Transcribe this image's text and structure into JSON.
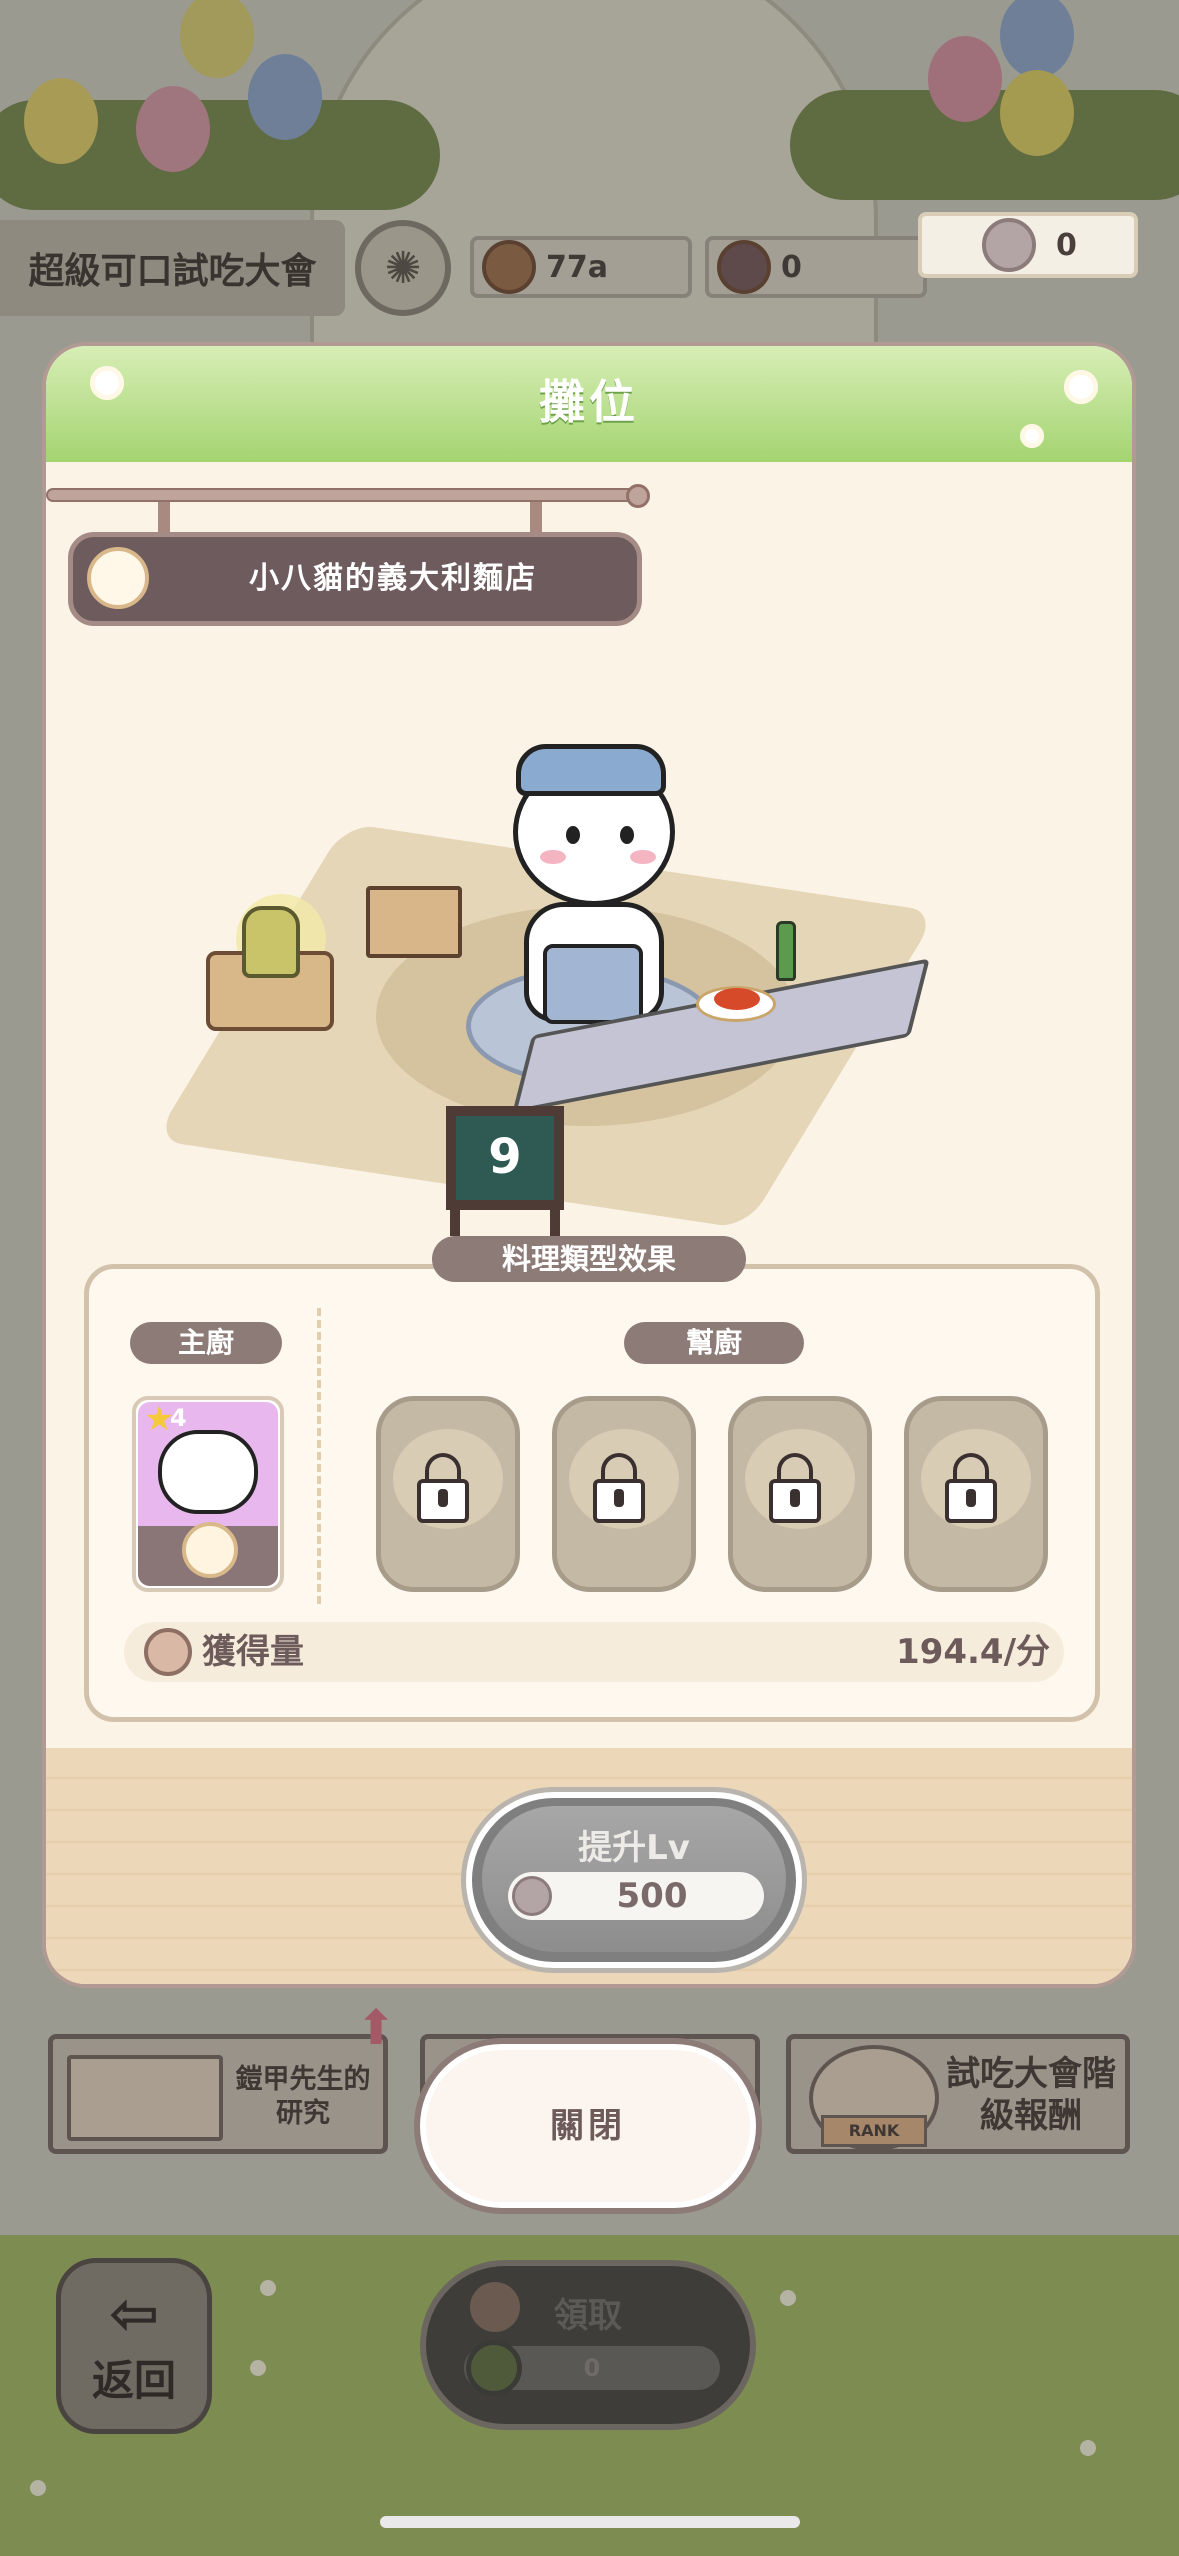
{
  "hud": {
    "title": "超級可口試吃大會",
    "currency_value": "77a",
    "hammer_value": "0",
    "ticket_value": "0"
  },
  "modal": {
    "title": "攤位",
    "shop_name": "小八貓的義大利麵店",
    "stall_number": "9",
    "effect_title": "料理類型效果",
    "head_chef_label": "主廚",
    "sous_chef_label": "幫廚",
    "head_chef_stars": "4",
    "yield_label": "獲得量",
    "yield_value": "194.4/分",
    "upgrade_label": "提升Lv",
    "upgrade_cost": "500"
  },
  "menu": {
    "research_label": "鎧甲先生的研究",
    "close_label": "關閉",
    "rank_reward_label": "試吃大會階級報酬",
    "rank_badge": "RANK",
    "back_label": "返回",
    "claim_label": "領取",
    "claim_value": "0"
  },
  "icons": [
    "lightbulb-icon",
    "coin-icon",
    "hammer-icon",
    "ticket-icon",
    "pasta-bowl-icon",
    "lock-icon",
    "chef-hat-icon",
    "exit-icon",
    "book-icon",
    "trophy-icon"
  ],
  "colors": {
    "header_green": "#a4d470",
    "panel_brown": "#8d7b77",
    "modal_bg": "#fbf4e6"
  }
}
